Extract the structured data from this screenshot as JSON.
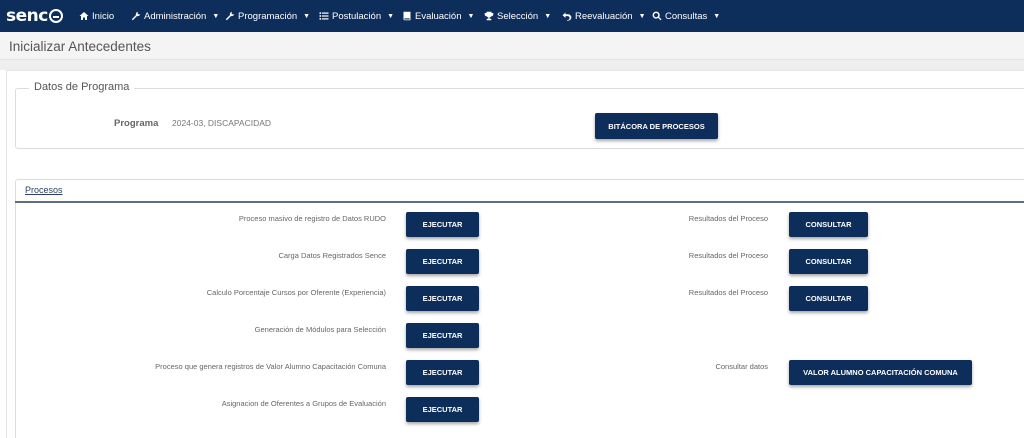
{
  "brand": {
    "logo_text": "senc"
  },
  "nav": {
    "items": [
      {
        "label": "Inicio",
        "icon": "home-icon"
      },
      {
        "label": "Administración",
        "icon": "wrench-icon"
      },
      {
        "label": "Programación",
        "icon": "wrench-icon"
      },
      {
        "label": "Postulación",
        "icon": "list-icon"
      },
      {
        "label": "Evaluación",
        "icon": "book-icon"
      },
      {
        "label": "Selección",
        "icon": "trophy-icon"
      },
      {
        "label": "Reevaluación",
        "icon": "undo-icon"
      },
      {
        "label": "Consultas",
        "icon": "search-icon"
      }
    ],
    "caret": "▼"
  },
  "page": {
    "title": "Inicializar Antecedentes"
  },
  "programa": {
    "legend": "Datos de Programa",
    "label": "Programa",
    "value": "2024-03, DISCAPACIDAD",
    "bitacora_label": "BITÁCORA DE PROCESOS"
  },
  "procesos": {
    "tab_label": "Procesos",
    "rows": [
      {
        "label": "Proceso masivo de registro de Datos RUDO",
        "action": "EJECUTAR",
        "result_label": "Resultados del Proceso",
        "result_action": "CONSULTAR"
      },
      {
        "label": "Carga Datos Registrados Sence",
        "action": "EJECUTAR",
        "result_label": "Resultados del Proceso",
        "result_action": "CONSULTAR"
      },
      {
        "label": "Calculo Porcentaje Cursos por Oferente (Experiencia)",
        "action": "EJECUTAR",
        "result_label": "Resultados del Proceso",
        "result_action": "CONSULTAR"
      },
      {
        "label": "Generación de Módulos para Selección",
        "action": "EJECUTAR"
      },
      {
        "label": "Proceso que genera registros de Valor Alumno Capacitación Comuna",
        "action": "EJECUTAR",
        "result_label": "Consultar datos",
        "result_action": "VALOR ALUMNO CAPACITACIÓN COMUNA"
      },
      {
        "label": "Asignacion de Oferentes a Grupos de Evaluación",
        "action": "EJECUTAR"
      }
    ]
  },
  "colors": {
    "navbar": "#0d2d5b",
    "button": "#0d2d5b"
  }
}
